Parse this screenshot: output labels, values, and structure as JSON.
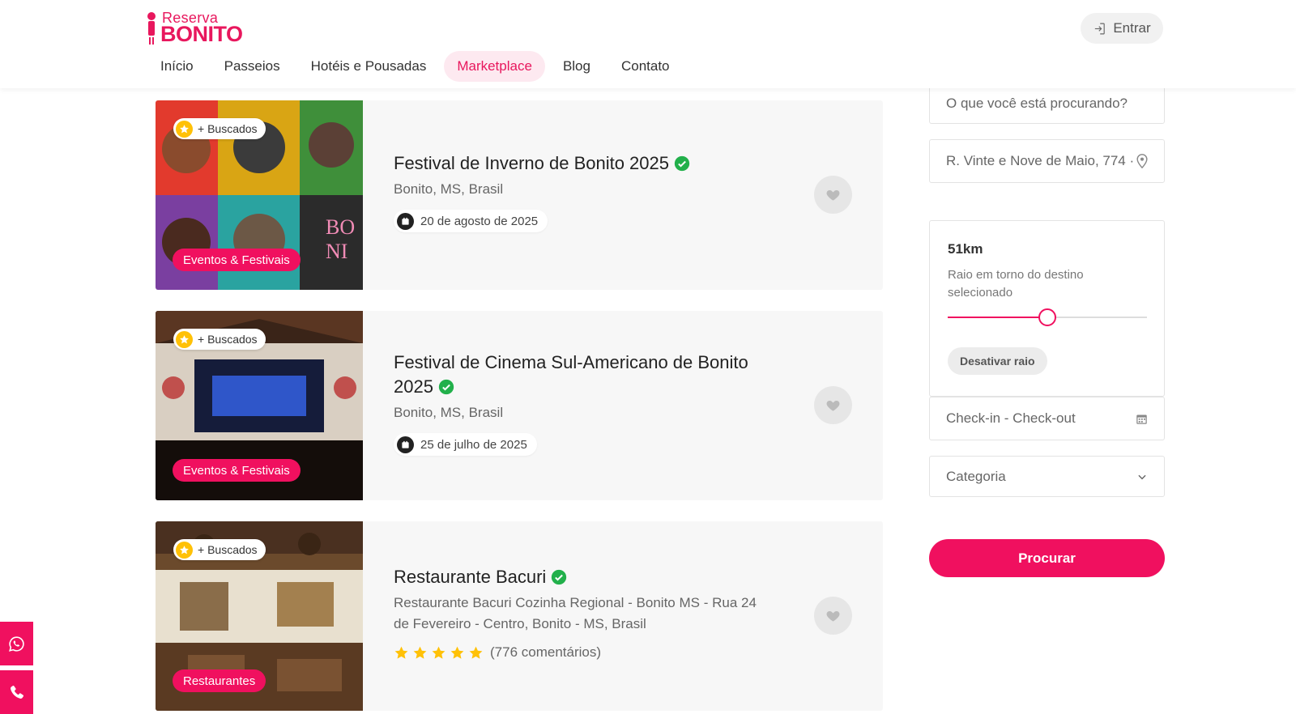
{
  "header": {
    "logo_top": "Reserva",
    "logo_bottom": "BONITO",
    "nav": [
      "Início",
      "Passeios",
      "Hotéis e Pousadas",
      "Marketplace",
      "Blog",
      "Contato"
    ],
    "active_nav": "Marketplace",
    "login_label": "Entrar"
  },
  "listings": [
    {
      "badge": "+ Buscados",
      "category": "Eventos & Festivais",
      "title": "Festival de Inverno de Bonito 2025",
      "location": "Bonito, MS, Brasil",
      "date": "20 de agosto de 2025",
      "verified": true
    },
    {
      "badge": "+ Buscados",
      "category": "Eventos & Festivais",
      "title": "Festival de Cinema Sul-Americano de Bonito 2025",
      "location": "Bonito, MS, Brasil",
      "date": "25 de julho de 2025",
      "verified": true
    },
    {
      "badge": "+ Buscados",
      "category": "Restaurantes",
      "title": "Restaurante Bacuri",
      "location": "Restaurante Bacuri Cozinha Regional - Bonito MS - Rua 24 de Fevereiro - Centro, Bonito - MS, Brasil",
      "rating": 5,
      "reviews": "(776 comentários)",
      "verified": true
    }
  ],
  "sidebar": {
    "search_placeholder": "O que você está procurando?",
    "location_value": "R. Vinte e Nove de Maio, 774 ·",
    "radius_value": "51km",
    "radius_desc": "Raio em torno do destino selecionado",
    "radius_fraction": 0.5,
    "radius_toggle": "Desativar raio",
    "dates_placeholder": "Check-in - Check-out",
    "category_placeholder": "Categoria",
    "search_button": "Procurar"
  },
  "icons": {
    "login": "login-icon",
    "verified": "verified-check-icon",
    "favorite": "heart-icon",
    "location": "map-pin-icon",
    "calendar": "calendar-icon",
    "dropdown": "chevron-down-icon",
    "whatsapp": "whatsapp-icon",
    "phone": "phone-icon"
  },
  "colors": {
    "brand": "#f0105f",
    "verified": "#22b04b",
    "star": "#ffc107"
  }
}
